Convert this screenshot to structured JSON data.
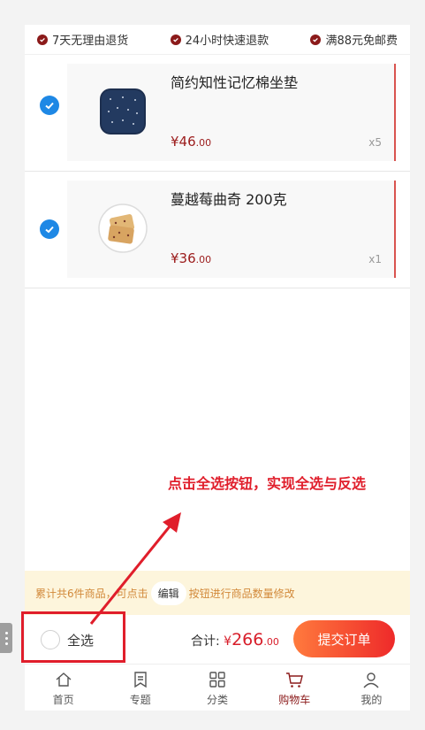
{
  "promo": {
    "items": [
      "7天无理由退货",
      "24小时快速退款",
      "满88元免邮费"
    ]
  },
  "cart": {
    "items": [
      {
        "name": "简约知性记忆棉坐垫",
        "price_int": "¥46",
        "price_dec": ".00",
        "qty": "x5",
        "selected": true
      },
      {
        "name": "蔓越莓曲奇 200克",
        "price_int": "¥36",
        "price_dec": ".00",
        "qty": "x1",
        "selected": true
      }
    ]
  },
  "annotation": "点击全选按钮，实现全选与反选",
  "notice": {
    "before": "累计共6件商品，可点击",
    "edit_label": "编辑",
    "after": "按钮进行商品数量修改"
  },
  "bottom": {
    "select_all": "全选",
    "total_label": "合计:",
    "yen": "¥",
    "total_int": "266",
    "total_dec": ".00",
    "submit": "提交订单"
  },
  "tabs": [
    {
      "label": "首页",
      "icon": "home-icon",
      "active": false
    },
    {
      "label": "专题",
      "icon": "bookmark-icon",
      "active": false
    },
    {
      "label": "分类",
      "icon": "category-grid-icon",
      "active": false
    },
    {
      "label": "购物车",
      "icon": "cart-icon",
      "active": true
    },
    {
      "label": "我的",
      "icon": "user-icon",
      "active": false
    }
  ],
  "colors": {
    "accent": "#8b1a1a",
    "annotation": "#e01e2b",
    "check": "#1e88e5"
  }
}
